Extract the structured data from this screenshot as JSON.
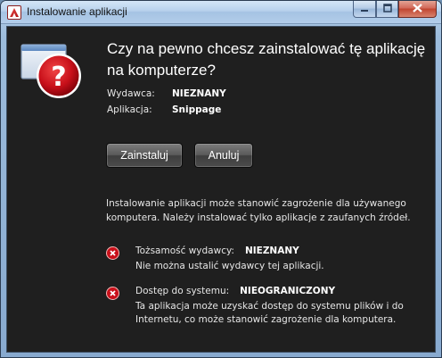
{
  "window": {
    "title": "Instalowanie aplikacji",
    "controls": {
      "minimize": "minimize-icon",
      "maximize": "maximize-icon",
      "close": "close-icon"
    }
  },
  "dialog": {
    "heading": "Czy na pewno chcesz zainstalować tę aplikację na komputerze?",
    "publisher_label": "Wydawca:",
    "publisher_value": "NIEZNANY",
    "application_label": "Aplikacja:",
    "application_value": "Snippage",
    "install_button": "Zainstaluj",
    "cancel_button": "Anuluj",
    "description": "Instalowanie aplikacji może stanowić zagrożenie dla używanego komputera. Należy instalować tylko aplikacje z zaufanych źródeł.",
    "risks": [
      {
        "title": "Tożsamość wydawcy:",
        "value": "NIEZNANY",
        "body": "Nie można ustalić wydawcy tej aplikacji."
      },
      {
        "title": "Dostęp do systemu:",
        "value": "NIEOGRANICZONY",
        "body": "Ta aplikacja może uzyskać dostęp do systemu plików i do Internetu, co może stanowić zagrożenie dla komputera."
      }
    ]
  },
  "colors": {
    "background": "#1f1f1f",
    "warning_red": "#c8101a",
    "text": "#ffffff"
  }
}
